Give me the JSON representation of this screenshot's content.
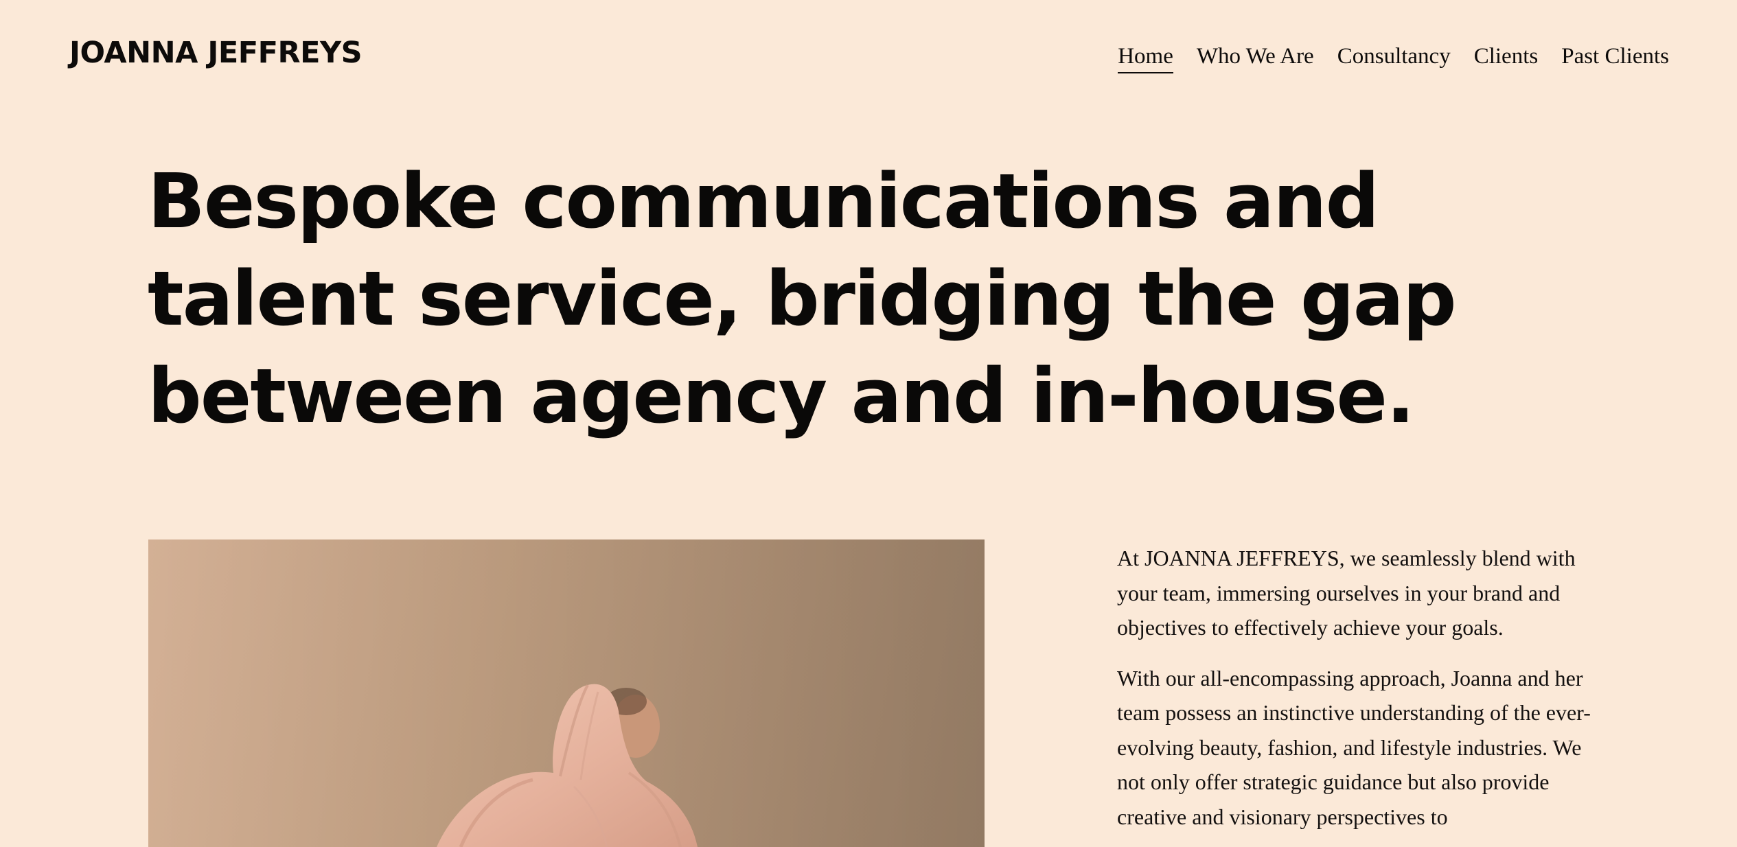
{
  "brand": {
    "logo_text": "JOANNA JEFFREYS"
  },
  "nav": {
    "items": [
      {
        "label": "Home",
        "active": true
      },
      {
        "label": "Who We Are",
        "active": false
      },
      {
        "label": "Consultancy",
        "active": false
      },
      {
        "label": "Clients",
        "active": false
      },
      {
        "label": "Past Clients",
        "active": false
      }
    ]
  },
  "hero": {
    "headline_lines": [
      "Bespoke communications and",
      "talent service, bridging the gap",
      "between agency and in-house."
    ]
  },
  "intro": {
    "paragraphs": [
      "At JOANNA JEFFREYS, we seamlessly blend with your team, immersing ourselves in your brand and objectives to effectively achieve your goals.",
      "With our all-encompassing approach, Joanna and her team possess an instinctive understanding of the ever-evolving beauty, fashion, and lifestyle industries. We not only offer strategic guidance but also provide creative and visionary perspectives to"
    ]
  },
  "colors": {
    "background": "#fbe9d8",
    "text": "#0d0b0a",
    "image_backdrop": "#c4a284",
    "garment": "#e9b8a5"
  }
}
